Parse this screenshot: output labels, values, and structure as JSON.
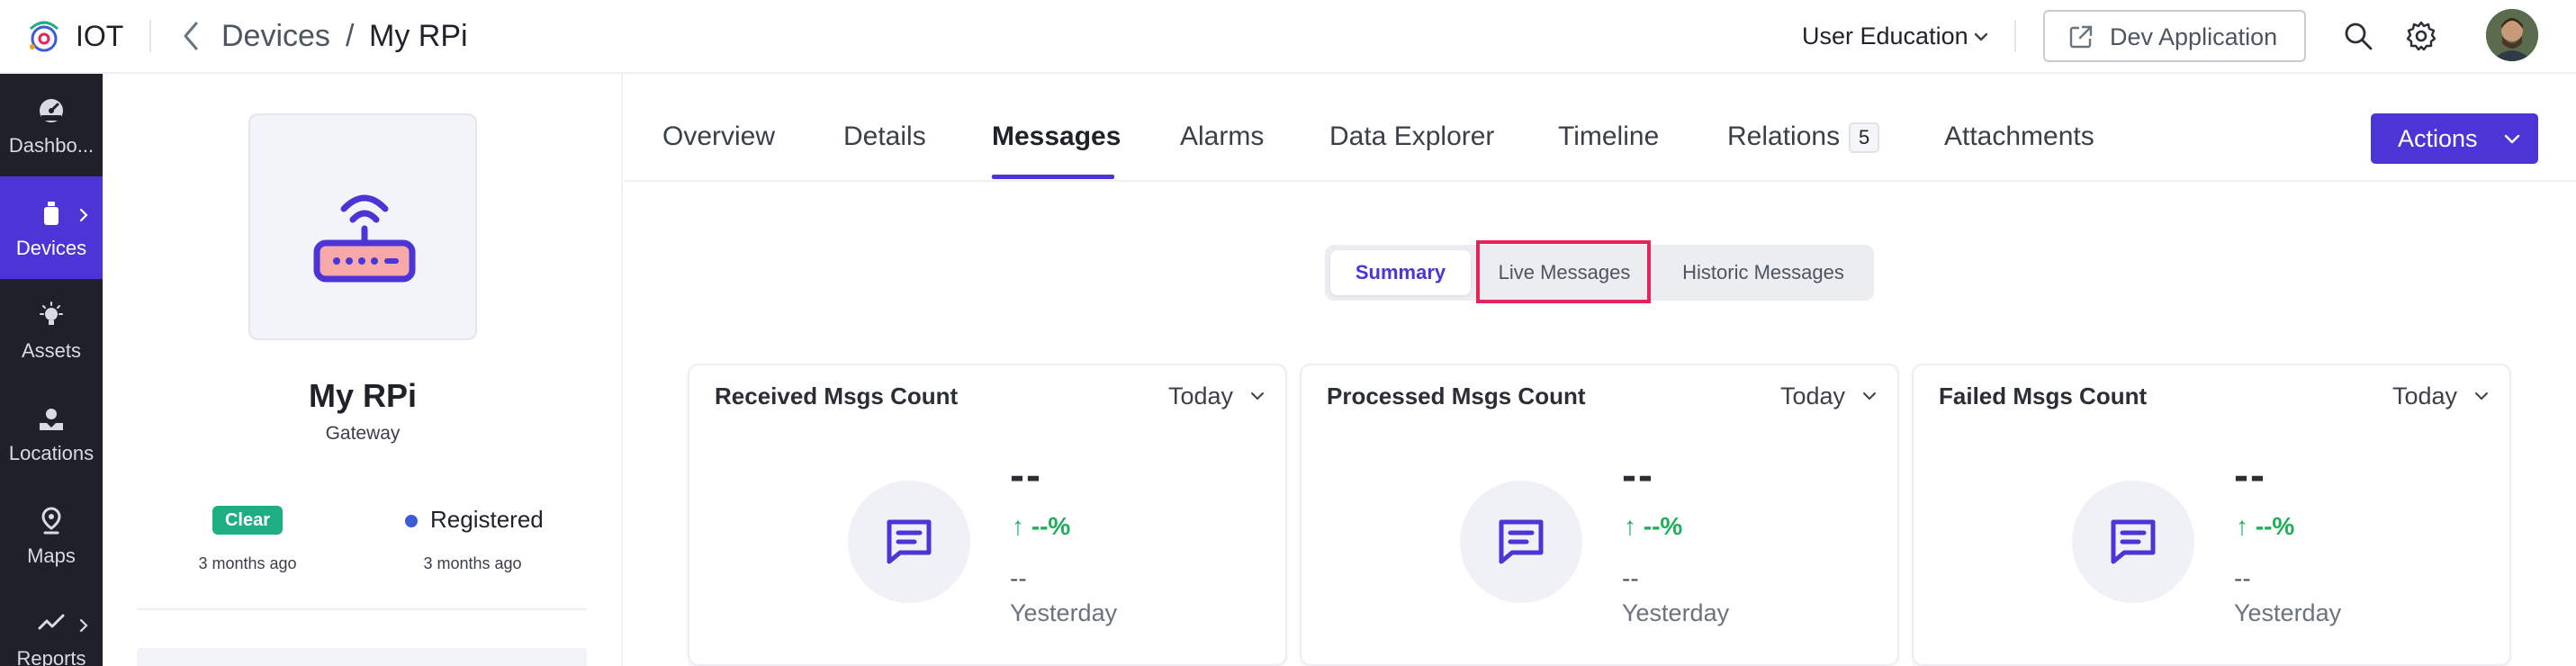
{
  "app": {
    "name": "IOT"
  },
  "breadcrumb": {
    "parent": "Devices",
    "separator": "/",
    "current": "My RPi"
  },
  "header": {
    "workspace": "User Education",
    "dev_app_label": "Dev Application"
  },
  "sidebar": {
    "items": [
      {
        "label": "Dashbo...",
        "icon": "dashboard-icon",
        "active": false
      },
      {
        "label": "Devices",
        "icon": "device-icon",
        "active": true
      },
      {
        "label": "Assets",
        "icon": "asset-bulb-icon",
        "active": false
      },
      {
        "label": "Locations",
        "icon": "location-icon",
        "active": false
      },
      {
        "label": "Maps",
        "icon": "map-pin-icon",
        "active": false
      },
      {
        "label": "Reports",
        "icon": "reports-icon",
        "active": false
      }
    ]
  },
  "device": {
    "name": "My RPi",
    "type": "Gateway",
    "alarm_status": "Clear",
    "alarm_time": "3 months ago",
    "registration_status": "Registered",
    "registration_time": "3 months ago"
  },
  "tabs": [
    {
      "label": "Overview"
    },
    {
      "label": "Details"
    },
    {
      "label": "Messages",
      "active": true
    },
    {
      "label": "Alarms"
    },
    {
      "label": "Data Explorer"
    },
    {
      "label": "Timeline"
    },
    {
      "label": "Relations",
      "count": "5"
    },
    {
      "label": "Attachments"
    }
  ],
  "actions_label": "Actions",
  "message_views": {
    "summary": "Summary",
    "live": "Live Messages",
    "historic": "Historic Messages",
    "selected": "Summary"
  },
  "cards": [
    {
      "title": "Received Msgs Count",
      "period": "Today",
      "value": "--",
      "trend": "↑ --%",
      "previous_value": "--",
      "previous_label": "Yesterday"
    },
    {
      "title": "Processed Msgs Count",
      "period": "Today",
      "value": "--",
      "trend": "↑ --%",
      "previous_value": "--",
      "previous_label": "Yesterday"
    },
    {
      "title": "Failed Msgs Count",
      "period": "Today",
      "value": "--",
      "trend": "↑ --%",
      "previous_value": "--",
      "previous_label": "Yesterday"
    }
  ],
  "colors": {
    "accent": "#4b35d6",
    "sidebar_bg": "#1e2127",
    "clear_badge": "#1fae82",
    "registered_dot": "#3c5bd6",
    "trend_up": "#1fae5a",
    "highlight_box": "#e5245c"
  }
}
